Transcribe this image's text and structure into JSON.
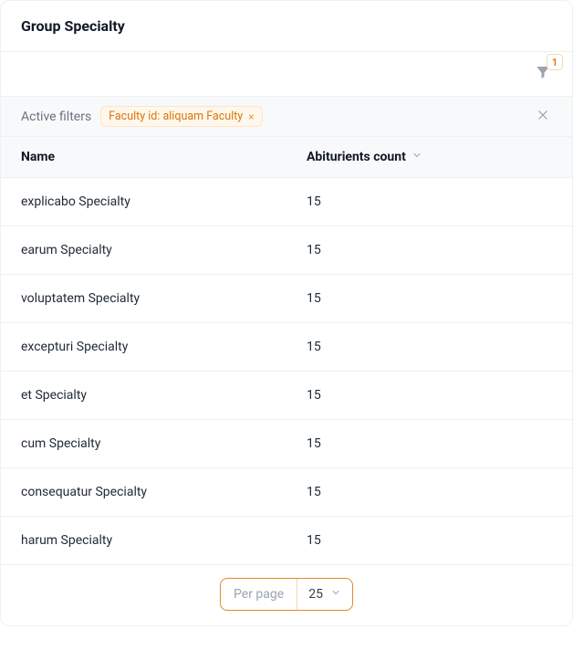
{
  "header": {
    "title": "Group Specialty"
  },
  "toolbar": {
    "filter_count": "1"
  },
  "filters": {
    "label": "Active filters",
    "chips": [
      {
        "text": "Faculty id: aliquam Faculty"
      }
    ]
  },
  "table": {
    "columns": {
      "name": "Name",
      "count": "Abiturients count"
    },
    "rows": [
      {
        "name": "explicabo Specialty",
        "count": "15"
      },
      {
        "name": "earum Specialty",
        "count": "15"
      },
      {
        "name": "voluptatem Specialty",
        "count": "15"
      },
      {
        "name": "excepturi Specialty",
        "count": "15"
      },
      {
        "name": "et Specialty",
        "count": "15"
      },
      {
        "name": "cum Specialty",
        "count": "15"
      },
      {
        "name": "consequatur Specialty",
        "count": "15"
      },
      {
        "name": "harum Specialty",
        "count": "15"
      }
    ]
  },
  "pagination": {
    "per_page_label": "Per page",
    "per_page_value": "25"
  }
}
